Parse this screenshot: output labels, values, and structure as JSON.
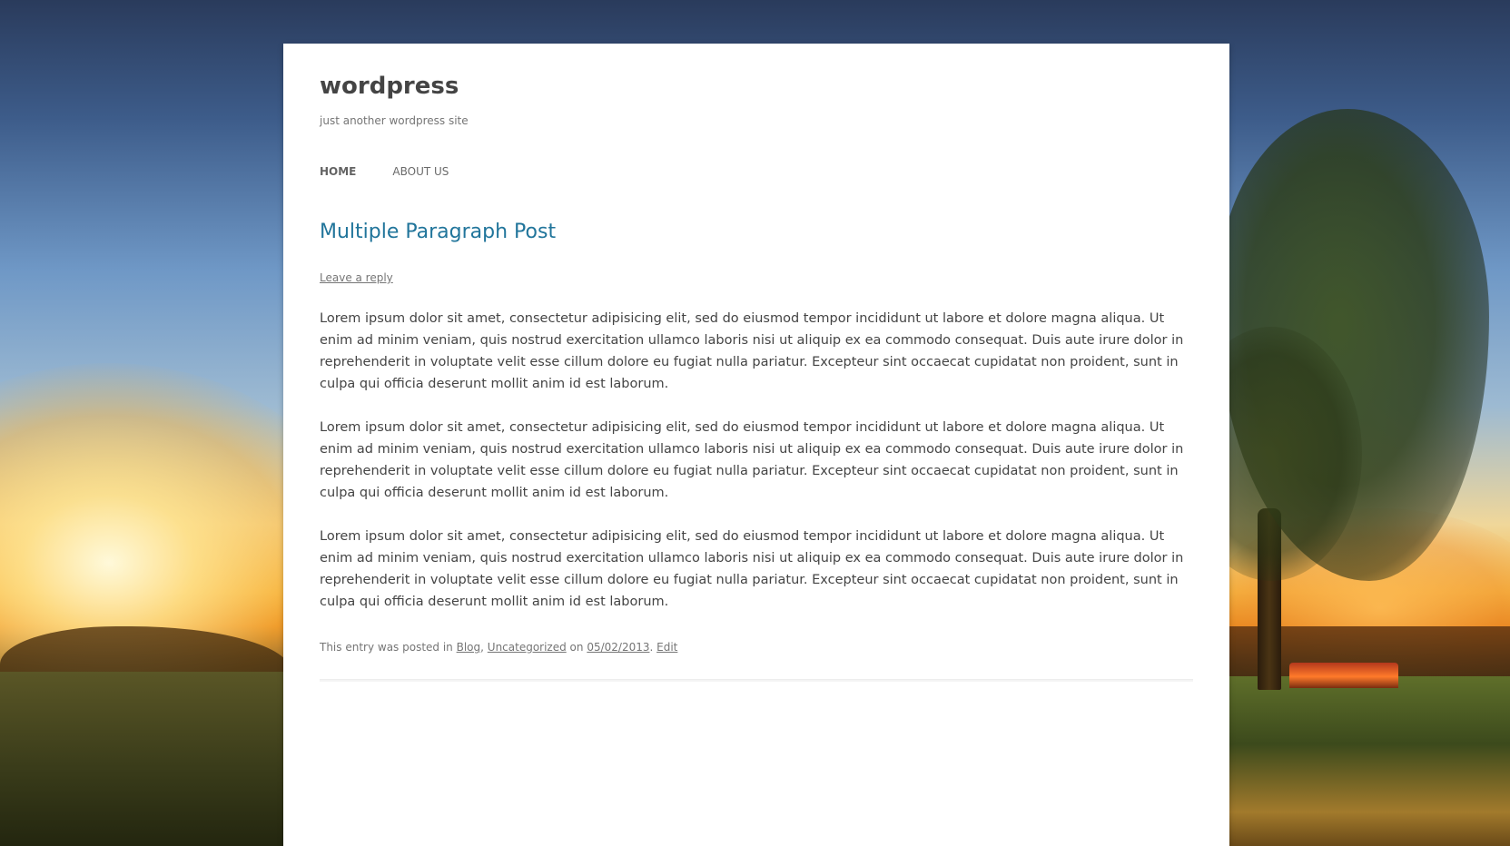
{
  "site": {
    "title": "wordpress",
    "description": "just another wordpress site"
  },
  "nav": {
    "items": [
      {
        "label": "HOME",
        "current": true
      },
      {
        "label": "ABOUT US",
        "current": false
      }
    ]
  },
  "post": {
    "title": "Multiple Paragraph Post",
    "leave_reply": "Leave a reply",
    "paragraphs": [
      "Lorem ipsum dolor sit amet, consectetur adipisicing elit, sed do eiusmod tempor incididunt ut labore et dolore magna aliqua. Ut enim ad minim veniam, quis nostrud exercitation ullamco laboris nisi ut aliquip ex ea commodo consequat. Duis aute irure dolor in reprehenderit in voluptate velit esse cillum dolore eu fugiat nulla pariatur. Excepteur sint occaecat cupidatat non proident, sunt in culpa qui officia deserunt mollit anim id est laborum.",
      "Lorem ipsum dolor sit amet, consectetur adipisicing elit, sed do eiusmod tempor incididunt ut labore et dolore magna aliqua. Ut enim ad minim veniam, quis nostrud exercitation ullamco laboris nisi ut aliquip ex ea commodo consequat. Duis aute irure dolor in reprehenderit in voluptate velit esse cillum dolore eu fugiat nulla pariatur. Excepteur sint occaecat cupidatat non proident, sunt in culpa qui officia deserunt mollit anim id est laborum.",
      "Lorem ipsum dolor sit amet, consectetur adipisicing elit, sed do eiusmod tempor incididunt ut labore et dolore magna aliqua. Ut enim ad minim veniam, quis nostrud exercitation ullamco laboris nisi ut aliquip ex ea commodo consequat. Duis aute irure dolor in reprehenderit in voluptate velit esse cillum dolore eu fugiat nulla pariatur. Excepteur sint occaecat cupidatat non proident, sunt in culpa qui officia deserunt mollit anim id est laborum."
    ],
    "meta": {
      "prefix": "This entry was posted in ",
      "category_1": "Blog",
      "separator": ", ",
      "category_2": "Uncategorized",
      "on_text": " on ",
      "date": "05/02/2013",
      "dot": ". ",
      "edit": "Edit"
    }
  },
  "colors": {
    "link_title": "#21759b",
    "text": "#444444",
    "meta": "#757575",
    "page_bg": "#ffffff"
  }
}
